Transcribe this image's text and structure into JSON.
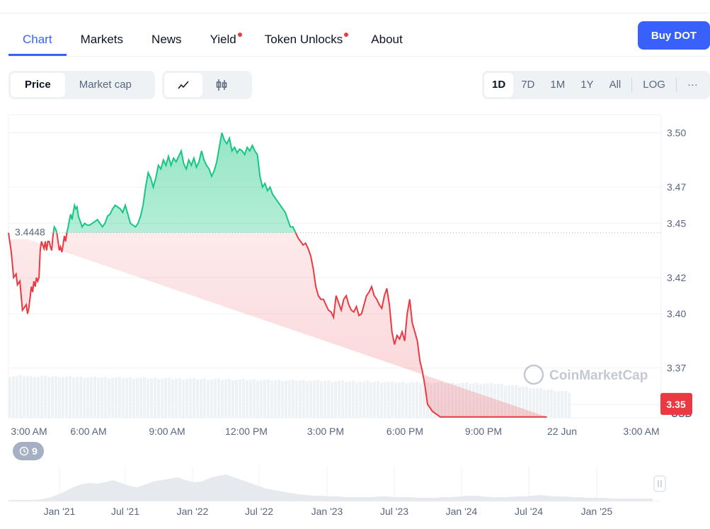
{
  "tabs": [
    {
      "label": "Chart",
      "active": true,
      "dot": false
    },
    {
      "label": "Markets",
      "active": false,
      "dot": false
    },
    {
      "label": "News",
      "active": false,
      "dot": false
    },
    {
      "label": "Yield",
      "active": false,
      "dot": true
    },
    {
      "label": "Token Unlocks",
      "active": false,
      "dot": true
    },
    {
      "label": "About",
      "active": false,
      "dot": false
    }
  ],
  "buy_button": "Buy DOT",
  "metric_toggle": {
    "price": "Price",
    "market_cap": "Market cap"
  },
  "chart_type_icons": [
    "line-chart-icon",
    "candlestick-icon"
  ],
  "ranges": [
    "1D",
    "7D",
    "1M",
    "1Y",
    "All",
    "LOG"
  ],
  "active_range": "1D",
  "more_label": "···",
  "badge_count": "9",
  "watermark": "CoinMarketCap",
  "colors": {
    "up": "#16c784",
    "down": "#ea3943",
    "accent": "#3861fb",
    "volume": "#cfd6e4"
  },
  "chart_data": {
    "type": "area",
    "ylabel": "USD",
    "ylim": [
      3.3425,
      3.51
    ],
    "yticks": [
      "3.50",
      "3.47",
      "3.45",
      "3.42",
      "3.40",
      "3.37",
      "3.35"
    ],
    "xticks": [
      "3:00 AM",
      "6:00 AM",
      "9:00 AM",
      "12:00 PM",
      "3:00 PM",
      "6:00 PM",
      "9:00 PM",
      "22 Jun",
      "3:00 AM"
    ],
    "reference_price": "3.4448",
    "current_price": "3.35",
    "x_hours": [
      0,
      0.1,
      0.15,
      0.2,
      0.3,
      0.35,
      0.45,
      0.5,
      0.55,
      0.7,
      0.75,
      0.8,
      0.9,
      0.95,
      1.0,
      1.05,
      1.1,
      1.15,
      1.2,
      1.25,
      1.3,
      1.35,
      1.4,
      1.45,
      1.5,
      1.55,
      1.6,
      1.65,
      1.7,
      1.75,
      1.8,
      1.85,
      1.9,
      1.95,
      2.0,
      2.05,
      2.1,
      2.15,
      2.2,
      2.25,
      2.3,
      2.35,
      2.4,
      2.45,
      2.5,
      2.55,
      2.6,
      2.65,
      2.7,
      2.75,
      2.8,
      2.9,
      3.0,
      3.1,
      3.2,
      3.3,
      3.4,
      3.5,
      3.6,
      3.7,
      3.8,
      3.9,
      4.0,
      4.1,
      4.2,
      4.3,
      4.4,
      4.5,
      4.6,
      4.7,
      4.8,
      4.9,
      5.0,
      5.1,
      5.2,
      5.3,
      5.4,
      5.5,
      5.6,
      5.7,
      5.8,
      5.9,
      6.0,
      6.1,
      6.2,
      6.3,
      6.4,
      6.5,
      6.6,
      6.7,
      6.8,
      6.9,
      7.0,
      7.1,
      7.2,
      7.3,
      7.4,
      7.5,
      7.6,
      7.7,
      7.8,
      7.9,
      8.0,
      8.1,
      8.2,
      8.3,
      8.4,
      8.5,
      8.6,
      8.7,
      8.8,
      8.9,
      9.0,
      9.1,
      9.2,
      9.3,
      9.4,
      9.5,
      9.6,
      9.7,
      9.8,
      9.9,
      10.0,
      10.1,
      10.2,
      10.3,
      10.4,
      10.5,
      10.6,
      10.7,
      10.8,
      10.9,
      11.0,
      11.1,
      11.2,
      11.3,
      11.4,
      11.5,
      11.6,
      11.7,
      11.8,
      11.9,
      12.0,
      12.1,
      12.2,
      12.3,
      12.4,
      12.5,
      12.6,
      12.7,
      12.8,
      12.9,
      13.0,
      13.1,
      13.2,
      13.3,
      13.4,
      13.5,
      13.6,
      13.7,
      13.8,
      13.9,
      14.0,
      14.1,
      14.2,
      14.3,
      14.4,
      14.5,
      14.6,
      14.7,
      14.8,
      14.9,
      15.0,
      15.1,
      15.2,
      15.3,
      15.4,
      15.5,
      15.6,
      15.7,
      15.8,
      15.9,
      16.0,
      16.1,
      16.2,
      16.3,
      16.4,
      16.5,
      16.6,
      16.7,
      16.8,
      16.9,
      17.0,
      17.1,
      17.2,
      17.3,
      17.4,
      17.5,
      17.6,
      17.7,
      17.8,
      17.9,
      18.0,
      18.1,
      18.2,
      18.3,
      18.4,
      18.5,
      18.6,
      18.7,
      18.8,
      18.9,
      19.0,
      19.1,
      19.2,
      19.3,
      19.4,
      19.5,
      19.6,
      19.7,
      19.8,
      19.9,
      20.0,
      20.1,
      20.2,
      20.3,
      20.4,
      20.5,
      20.6,
      20.7,
      20.8,
      20.9,
      21.0,
      21.1,
      21.2,
      21.3,
      21.4,
      21.5
    ],
    "values": [
      3.4448,
      3.435,
      3.428,
      3.42,
      3.422,
      3.416,
      3.418,
      3.41,
      3.402,
      3.405,
      3.4,
      3.403,
      3.415,
      3.412,
      3.418,
      3.415,
      3.42,
      3.418,
      3.42,
      3.435,
      3.44,
      3.438,
      3.436,
      3.44,
      3.435,
      3.44,
      3.44,
      3.437,
      3.435,
      3.443,
      3.448,
      3.447,
      3.445,
      3.44,
      3.435,
      3.437,
      3.434,
      3.438,
      3.443,
      3.44,
      3.445,
      3.448,
      3.452,
      3.455,
      3.452,
      3.456,
      3.46,
      3.458,
      3.459,
      3.454,
      3.452,
      3.448,
      3.45,
      3.449,
      3.449,
      3.45,
      3.451,
      3.452,
      3.45,
      3.448,
      3.45,
      3.454,
      3.455,
      3.458,
      3.46,
      3.459,
      3.458,
      3.456,
      3.46,
      3.455,
      3.45,
      3.449,
      3.448,
      3.45,
      3.454,
      3.46,
      3.47,
      3.478,
      3.475,
      3.47,
      3.475,
      3.482,
      3.48,
      3.485,
      3.482,
      3.487,
      3.482,
      3.486,
      3.484,
      3.487,
      3.49,
      3.483,
      3.48,
      3.485,
      3.482,
      3.486,
      3.481,
      3.484,
      3.49,
      3.485,
      3.482,
      3.48,
      3.476,
      3.479,
      3.484,
      3.492,
      3.5,
      3.496,
      3.494,
      3.497,
      3.49,
      3.492,
      3.489,
      3.491,
      3.49,
      3.488,
      3.492,
      3.49,
      3.493,
      3.49,
      3.488,
      3.476,
      3.47,
      3.472,
      3.468,
      3.47,
      3.466,
      3.464,
      3.462,
      3.46,
      3.458,
      3.456,
      3.452,
      3.448,
      3.448,
      3.445,
      3.442,
      3.44,
      3.438,
      3.439,
      3.436,
      3.432,
      3.425,
      3.415,
      3.41,
      3.408,
      3.408,
      3.405,
      3.402,
      3.401,
      3.398,
      3.41,
      3.406,
      3.402,
      3.408,
      3.41,
      3.405,
      3.402,
      3.401,
      3.404,
      3.399,
      3.4,
      3.405,
      3.41,
      3.412,
      3.415,
      3.41,
      3.408,
      3.405,
      3.403,
      3.41,
      3.414,
      3.405,
      3.39,
      3.383,
      3.388,
      3.386,
      3.39,
      3.385,
      3.4,
      3.408,
      3.395,
      3.39,
      3.385,
      3.374,
      3.368,
      3.36,
      3.35,
      3.348,
      3.346,
      3.345,
      3.344,
      3.343,
      3.343,
      3.343,
      3.343,
      3.343,
      3.343,
      3.343,
      3.343,
      3.343,
      3.343,
      3.343,
      3.343,
      3.343,
      3.343,
      3.343,
      3.343,
      3.343,
      3.343,
      3.343,
      3.343,
      3.343,
      3.343,
      3.343,
      3.343,
      3.343,
      3.343,
      3.343,
      3.343,
      3.343,
      3.343,
      3.343,
      3.343,
      3.343,
      3.343,
      3.343,
      3.343,
      3.343,
      3.343,
      3.343,
      3.343,
      3.343,
      3.343,
      3.343
    ],
    "navigator_xticks": [
      "Jan '21",
      "Jul '21",
      "Jan '22",
      "Jul '22",
      "Jan '23",
      "Jul '23",
      "Jan '24",
      "Jul '24",
      "Jan '25"
    ]
  }
}
